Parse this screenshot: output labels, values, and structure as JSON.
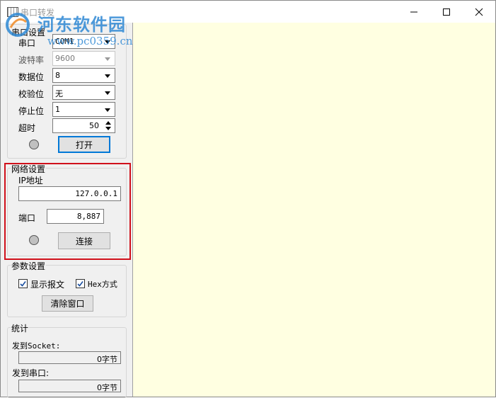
{
  "window": {
    "title": "串口转发",
    "watermark_name": "河东软件园",
    "watermark_url": "www.pc0359.cn"
  },
  "serial": {
    "group_title": "串口设置",
    "port_label": "串口",
    "port_value": "COM1",
    "baud_label": "波特率",
    "baud_value": "9600",
    "databits_label": "数据位",
    "databits_value": "8",
    "parity_label": "校验位",
    "parity_value": "无",
    "stopbits_label": "停止位",
    "stopbits_value": "1",
    "timeout_label": "超时",
    "timeout_value": "50",
    "open_button": "打开"
  },
  "network": {
    "group_title": "网络设置",
    "ip_label": "IP地址",
    "ip_value": "127.0.0.1",
    "port_label": "端口",
    "port_value": "8,887",
    "connect_button": "连接"
  },
  "params": {
    "group_title": "参数设置",
    "show_message_label": "显示报文",
    "show_message_checked": true,
    "hex_label": "Hex方式",
    "hex_checked": true,
    "clear_button": "清除窗口"
  },
  "stats": {
    "group_title": "统计",
    "to_socket_label": "发到Socket:",
    "to_socket_value": "0字节",
    "to_serial_label": "发到串口:",
    "to_serial_value": "0字节"
  },
  "colors": {
    "log_background": "#ffffe1",
    "highlight_border": "#d0101b",
    "watermark": "#2e88d4",
    "focus_border": "#0078d7"
  }
}
